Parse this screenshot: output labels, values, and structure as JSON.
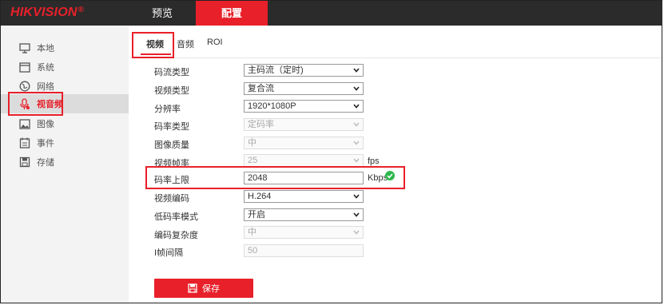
{
  "brand": {
    "logo": "HIKVISION",
    "reg": "®"
  },
  "nav": {
    "preview": "预览",
    "config": "配置"
  },
  "sidebar": {
    "items": [
      {
        "label": "本地",
        "icon": "monitor-icon"
      },
      {
        "label": "系统",
        "icon": "window-icon"
      },
      {
        "label": "网络",
        "icon": "globe-icon"
      },
      {
        "label": "视音频",
        "icon": "microphone-icon",
        "active": true
      },
      {
        "label": "图像",
        "icon": "image-icon"
      },
      {
        "label": "事件",
        "icon": "calendar-icon"
      },
      {
        "label": "存储",
        "icon": "disk-icon"
      }
    ]
  },
  "tabs": [
    {
      "label": "视频",
      "active": true
    },
    {
      "label": "音频"
    },
    {
      "label": "ROI"
    }
  ],
  "form": {
    "stream_type": {
      "label": "码流类型",
      "value": "主码流（定时)"
    },
    "video_type": {
      "label": "视频类型",
      "value": "复合流"
    },
    "resolution": {
      "label": "分辨率",
      "value": "1920*1080P"
    },
    "bitrate_type": {
      "label": "码率类型",
      "value": "定码率"
    },
    "image_quality": {
      "label": "图像质量",
      "value": "中"
    },
    "frame_rate": {
      "label": "视频帧率",
      "value": "25",
      "unit": "fps"
    },
    "max_bitrate": {
      "label": "码率上限",
      "value": "2048",
      "unit": "Kbps"
    },
    "video_encoding": {
      "label": "视频编码",
      "value": "H.264"
    },
    "low_bitrate_mode": {
      "label": "低码率模式",
      "value": "开启"
    },
    "encoding_complexity": {
      "label": "编码复杂度",
      "value": "中"
    },
    "i_frame_interval": {
      "label": "I帧间隔",
      "value": "50"
    }
  },
  "save_label": "保存",
  "colors": {
    "accent": "#e8202a",
    "topbar": "#2b2b2b",
    "check": "#2db84d"
  }
}
